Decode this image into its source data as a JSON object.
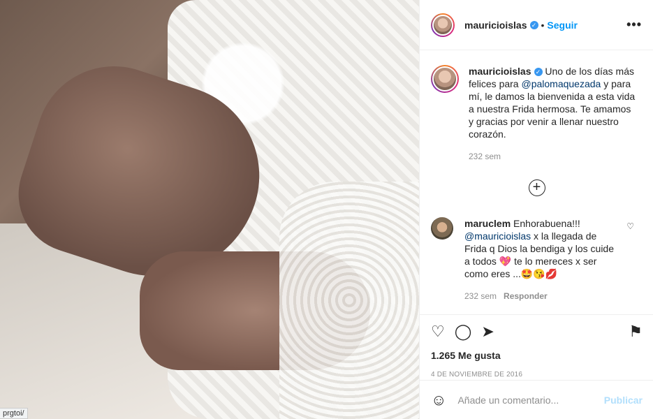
{
  "photo": {
    "url_chip": "prgtoi/"
  },
  "header": {
    "username": "mauricioislas",
    "verified": "✓",
    "separator": "•",
    "follow": "Seguir",
    "more": "•••"
  },
  "caption": {
    "username": "mauricioislas",
    "text_before": " Uno de los días más felices para ",
    "mention": "@palomaquezada",
    "text_after": " y para mí, le damos la bienvenida a esta vida a nuestra Frida hermosa. Te amamos y gracias por venir a llenar nuestro corazón.",
    "time": "232 sem"
  },
  "load_more": "+",
  "comment": {
    "username": "maruclem",
    "text_before": " Enhorabuena!!! ",
    "mention": "@mauricioislas",
    "text_after": " x la llegada de Frida q Dios la bendiga y los cuide a todos 💖 te lo mereces x ser como eres ...🤩😘💋",
    "time": "232 sem",
    "reply": "Responder",
    "like": "♡"
  },
  "actions": {
    "like": "♡",
    "comment": "◯",
    "share": "➤",
    "save": "⚑"
  },
  "likes": "1.265 Me gusta",
  "date": "4 DE NOVIEMBRE DE 2016",
  "composer": {
    "emoji": "☺",
    "placeholder": "Añade un comentario...",
    "publish": "Publicar"
  }
}
